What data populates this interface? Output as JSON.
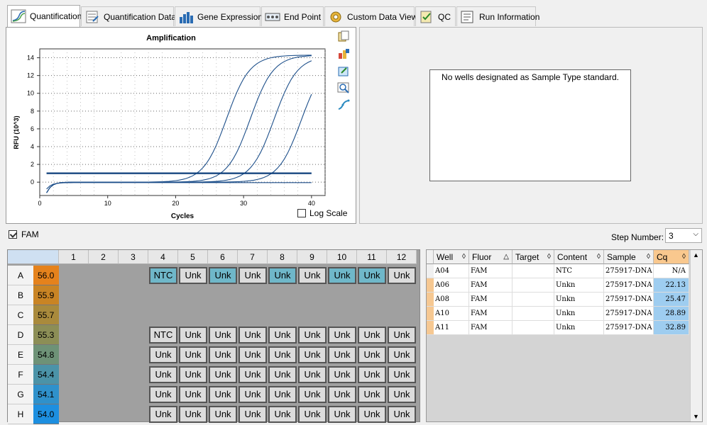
{
  "tabs": [
    {
      "label": "Quantification",
      "icon": "amplification-curve-icon",
      "active": true
    },
    {
      "label": "Quantification Data",
      "icon": "data-table-icon"
    },
    {
      "label": "Gene Expression",
      "icon": "bar-chart-icon"
    },
    {
      "label": "End Point",
      "icon": "end-point-icon"
    },
    {
      "label": "Custom Data View",
      "icon": "custom-view-gear-icon"
    },
    {
      "label": "QC",
      "icon": "qc-checklist-icon"
    },
    {
      "label": "Run Information",
      "icon": "run-info-icon"
    }
  ],
  "chart_data": {
    "type": "line",
    "title": "Amplification",
    "xlabel": "Cycles",
    "ylabel": "RFU (10^3)",
    "xlim": [
      0,
      42
    ],
    "ylim": [
      -1.5,
      15
    ],
    "xticks": [
      0,
      10,
      20,
      30,
      40
    ],
    "yticks": [
      0,
      2,
      4,
      6,
      8,
      10,
      12,
      14
    ],
    "grid": true,
    "threshold": 1.0,
    "series": [
      {
        "well": "A06",
        "midpoint": 27.5,
        "plateau": 14.3
      },
      {
        "well": "A08",
        "midpoint": 31.0,
        "plateau": 14.3
      },
      {
        "well": "A10",
        "midpoint": 34.5,
        "plateau": 14.2
      },
      {
        "well": "A11",
        "midpoint": 38.5,
        "plateau": 14.0
      },
      {
        "well": "A04",
        "midpoint": null,
        "plateau": 0
      }
    ]
  },
  "chart_tools": [
    "copy-icon",
    "chart-options-icon",
    "export-icon",
    "zoom-icon",
    "trace-style-icon"
  ],
  "log_scale": {
    "label": "Log Scale",
    "checked": false
  },
  "standard_message": "No wells designated as Sample Type standard.",
  "fam": {
    "label": "FAM",
    "checked": true
  },
  "step": {
    "label": "Step Number:",
    "value": "3"
  },
  "plate": {
    "columns": [
      "1",
      "2",
      "3",
      "4",
      "5",
      "6",
      "7",
      "8",
      "9",
      "10",
      "11",
      "12"
    ],
    "rows": [
      {
        "label": "A",
        "temp": "56.0",
        "temp_color": "#e5821c",
        "wells": [
          "",
          "",
          "",
          "NTC",
          "Unk",
          "Unk",
          "Unk",
          "Unk",
          "Unk",
          "Unk",
          "Unk",
          "Unk"
        ],
        "selected": [
          4,
          6,
          8,
          10,
          11
        ]
      },
      {
        "label": "B",
        "temp": "55.9",
        "temp_color": "#c98424",
        "wells": [
          "",
          "",
          "",
          "",
          "",
          "",
          "",
          "",
          "",
          "",
          "",
          ""
        ],
        "selected": []
      },
      {
        "label": "C",
        "temp": "55.7",
        "temp_color": "#a98a3c",
        "wells": [
          "",
          "",
          "",
          "",
          "",
          "",
          "",
          "",
          "",
          "",
          "",
          ""
        ],
        "selected": []
      },
      {
        "label": "D",
        "temp": "55.3",
        "temp_color": "#8c8e56",
        "wells": [
          "",
          "",
          "",
          "NTC",
          "Unk",
          "Unk",
          "Unk",
          "Unk",
          "Unk",
          "Unk",
          "Unk",
          "Unk"
        ],
        "selected": []
      },
      {
        "label": "E",
        "temp": "54.8",
        "temp_color": "#6e9277",
        "wells": [
          "",
          "",
          "",
          "Unk",
          "Unk",
          "Unk",
          "Unk",
          "Unk",
          "Unk",
          "Unk",
          "Unk",
          "Unk"
        ],
        "selected": []
      },
      {
        "label": "F",
        "temp": "54.4",
        "temp_color": "#4b93a8",
        "wells": [
          "",
          "",
          "",
          "Unk",
          "Unk",
          "Unk",
          "Unk",
          "Unk",
          "Unk",
          "Unk",
          "Unk",
          "Unk"
        ],
        "selected": []
      },
      {
        "label": "G",
        "temp": "54.1",
        "temp_color": "#2f91cb",
        "wells": [
          "",
          "",
          "",
          "Unk",
          "Unk",
          "Unk",
          "Unk",
          "Unk",
          "Unk",
          "Unk",
          "Unk",
          "Unk"
        ],
        "selected": []
      },
      {
        "label": "H",
        "temp": "54.0",
        "temp_color": "#1d8fe0",
        "wells": [
          "",
          "",
          "",
          "Unk",
          "Unk",
          "Unk",
          "Unk",
          "Unk",
          "Unk",
          "Unk",
          "Unk",
          "Unk"
        ],
        "selected": []
      }
    ]
  },
  "table": {
    "headers": [
      "Well",
      "Fluor",
      "Target",
      "Content",
      "Sample",
      "Cq"
    ],
    "rows": [
      {
        "well": "A04",
        "fluor": "FAM",
        "target": "",
        "content": "NTC",
        "sample": "275917-DNA",
        "cq": "N/A"
      },
      {
        "well": "A06",
        "fluor": "FAM",
        "target": "",
        "content": "Unkn",
        "sample": "275917-DNA",
        "cq": "22.13"
      },
      {
        "well": "A08",
        "fluor": "FAM",
        "target": "",
        "content": "Unkn",
        "sample": "275917-DNA",
        "cq": "25.47"
      },
      {
        "well": "A10",
        "fluor": "FAM",
        "target": "",
        "content": "Unkn",
        "sample": "275917-DNA",
        "cq": "28.89"
      },
      {
        "well": "A11",
        "fluor": "FAM",
        "target": "",
        "content": "Unkn",
        "sample": "275917-DNA",
        "cq": "32.89"
      }
    ]
  }
}
